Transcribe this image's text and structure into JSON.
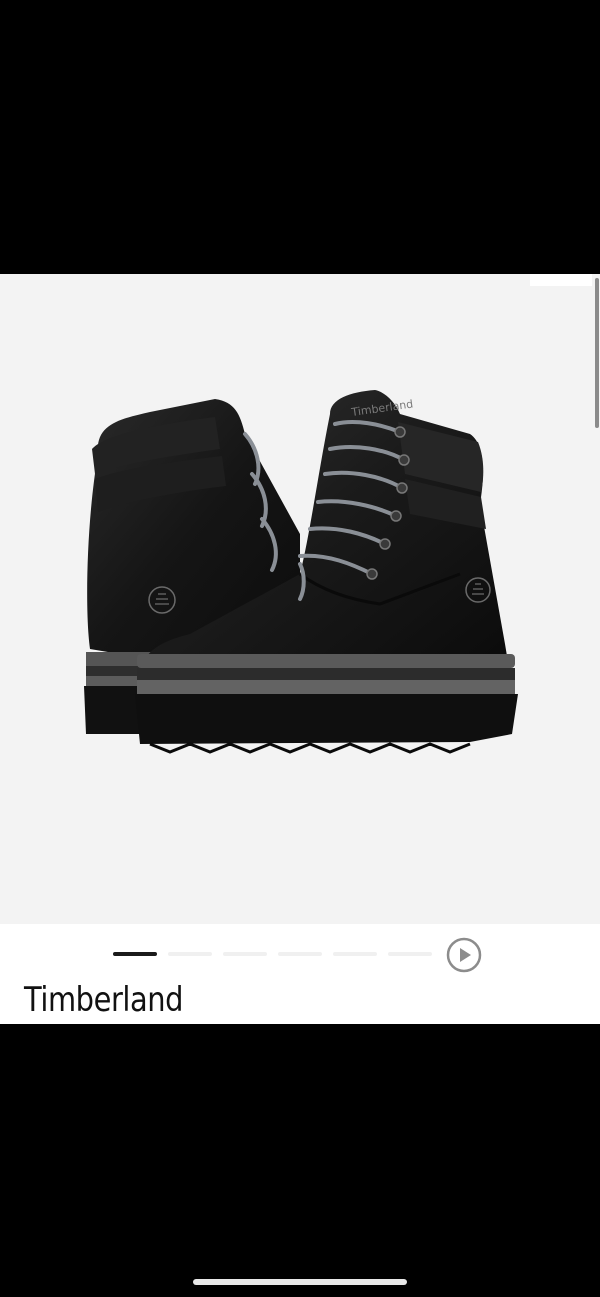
{
  "product": {
    "brand": "Timberland",
    "image_alt": "Black leather lace-up boots pair",
    "logo_text": "Timberland"
  },
  "gallery": {
    "slide_count": 6,
    "active_index": 0,
    "play_icon": "play-icon"
  },
  "colors": {
    "background": "#000000",
    "image_bg": "#f3f3f3",
    "active_dot": "#1a1a1a",
    "inactive_dot": "#f0f0f0",
    "play_icon": "#8c8c8c"
  }
}
